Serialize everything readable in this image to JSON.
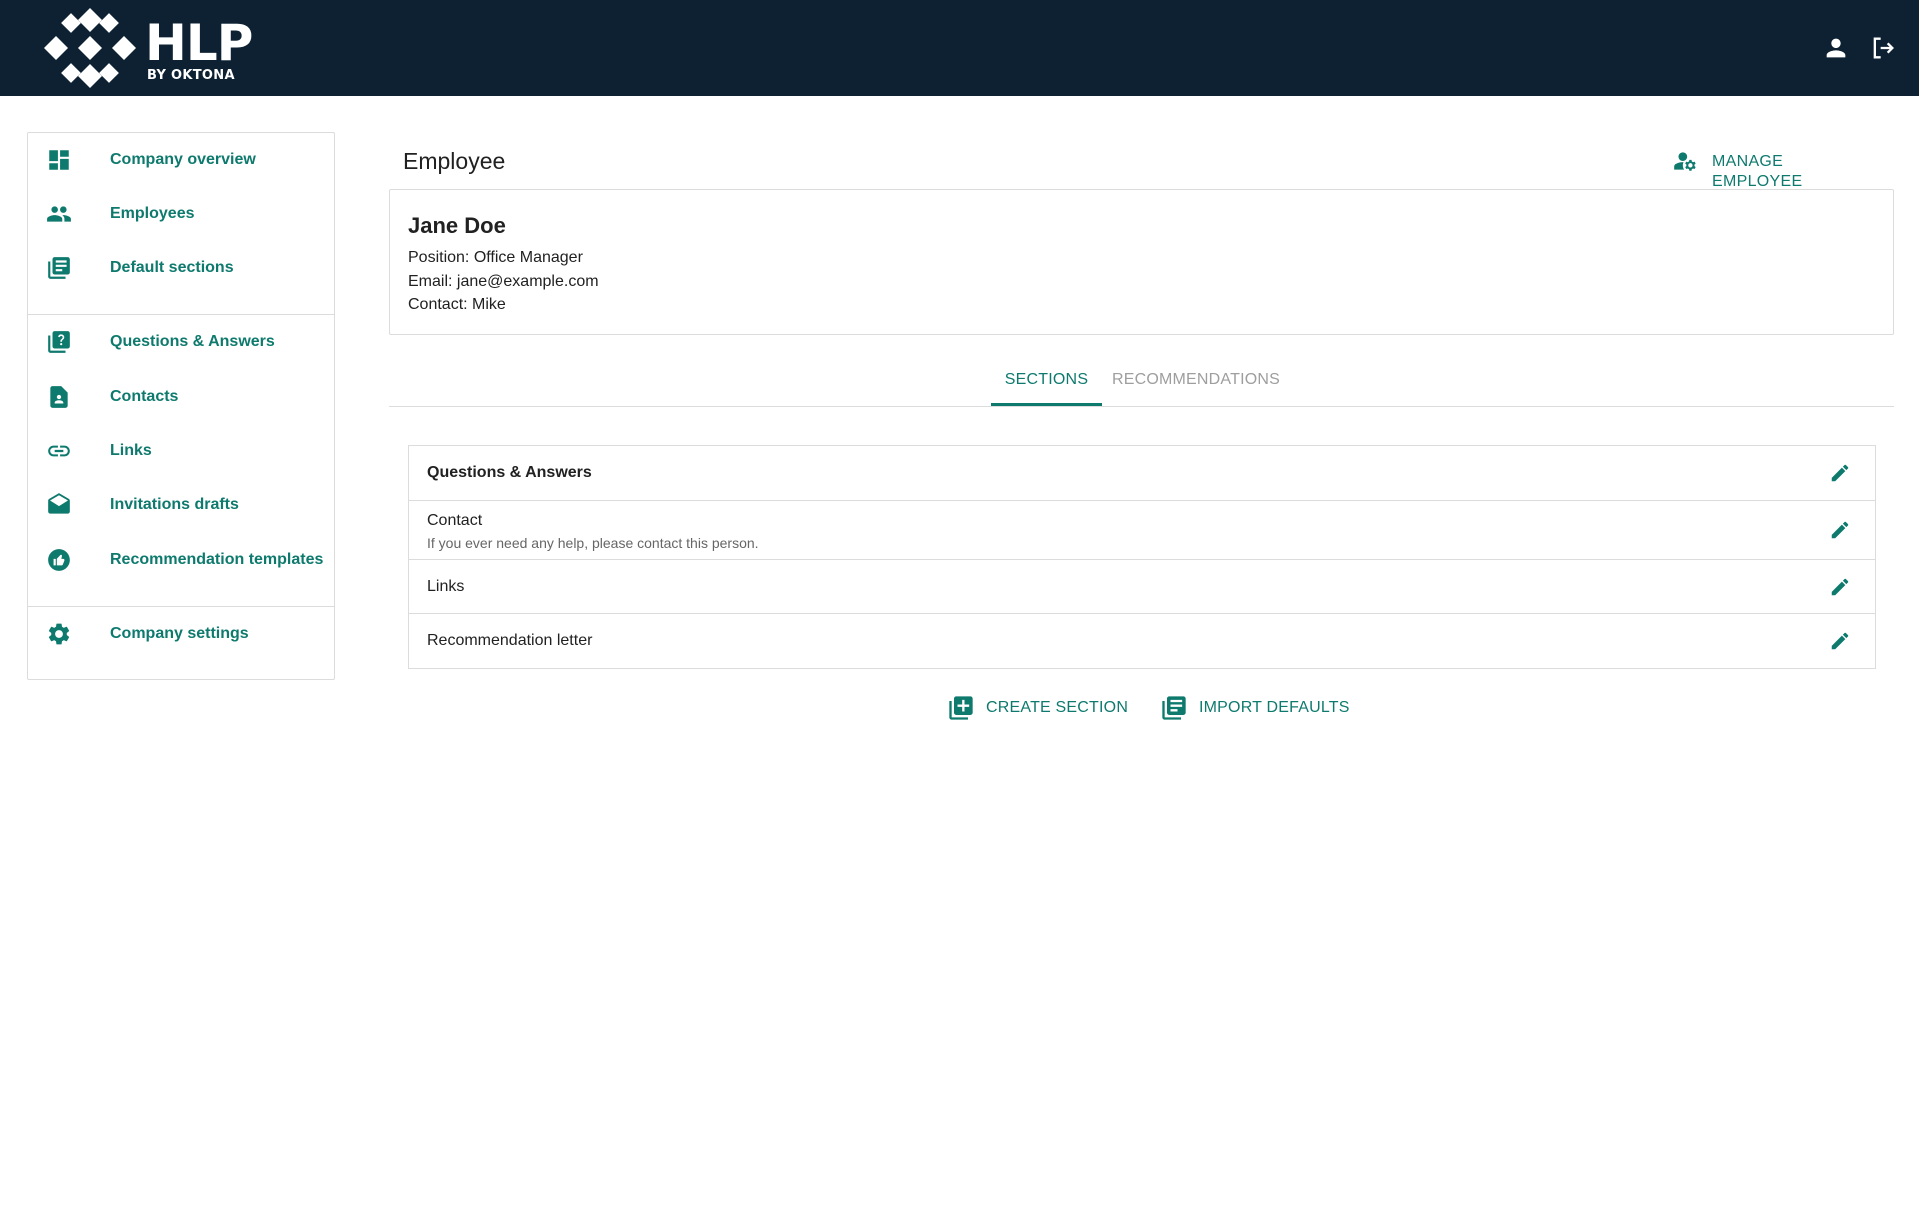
{
  "app": {
    "logo_title": "HLP",
    "logo_subtitle": "BY OKTONA"
  },
  "header_icons": [
    "account-icon",
    "logout-icon"
  ],
  "sidebar": {
    "items": [
      {
        "label": "Company overview",
        "icon": "dashboard-icon"
      },
      {
        "label": "Employees",
        "icon": "people-icon"
      },
      {
        "label": "Default sections",
        "icon": "library-books-icon"
      },
      {
        "label": "Questions & Answers",
        "icon": "quiz-icon"
      },
      {
        "label": "Contacts",
        "icon": "contact-page-icon"
      },
      {
        "label": "Links",
        "icon": "link-icon"
      },
      {
        "label": "Invitations drafts",
        "icon": "drafts-icon"
      },
      {
        "label": "Recommendation templates",
        "icon": "thumb-up-icon"
      },
      {
        "label": "Company settings",
        "icon": "gear-icon"
      }
    ]
  },
  "main": {
    "page_title": "Employee",
    "manage_label": "MANAGE EMPLOYEE",
    "employee": {
      "name": "Jane Doe",
      "position": "Position: Office Manager",
      "email": "Email: jane@example.com",
      "contact": "Contact: Mike"
    },
    "tabs": [
      {
        "label": "SECTIONS",
        "active": true
      },
      {
        "label": "RECOMMENDATIONS",
        "active": false
      }
    ],
    "sections": [
      {
        "title": "Questions & Answers",
        "description": ""
      },
      {
        "title": "Contact",
        "description": "If you ever need any help, please contact this person."
      },
      {
        "title": "Links",
        "description": ""
      },
      {
        "title": "Recommendation letter",
        "description": ""
      }
    ],
    "create_label": "CREATE SECTION",
    "import_label": "IMPORT DEFAULTS"
  },
  "colors": {
    "header_bg": "#0d2133",
    "accent": "#0e7a6e",
    "border": "#dcdcdc",
    "inactive_tab": "#9e9e9e"
  }
}
